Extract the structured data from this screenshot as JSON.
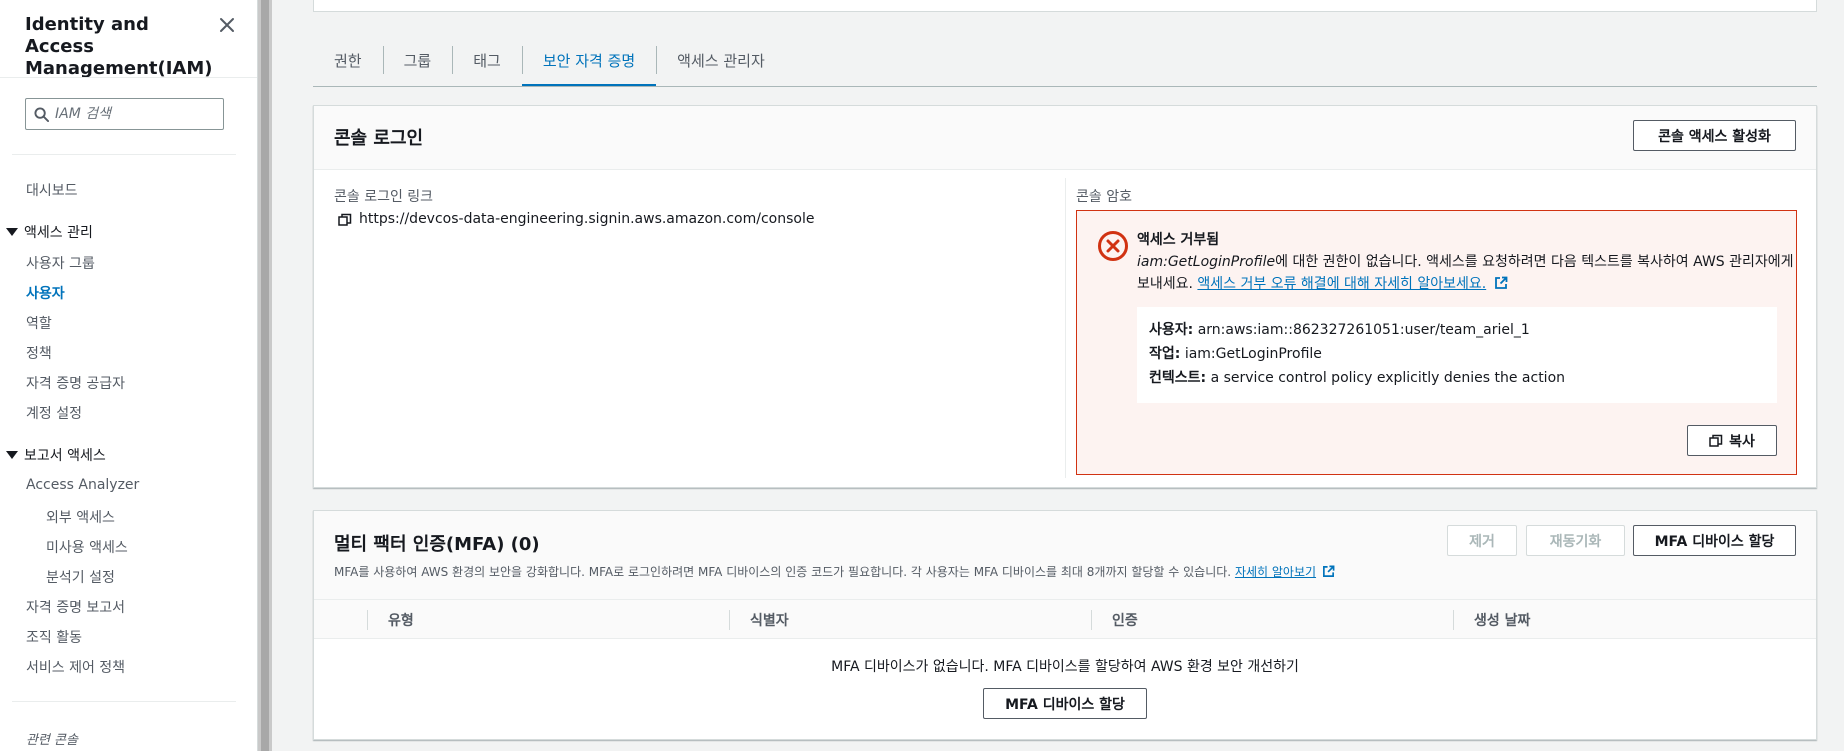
{
  "sidebar": {
    "title": "Identity and Access Management(IAM)",
    "search_placeholder": "IAM 검색",
    "dashboard": "대시보드",
    "access_mgmt": {
      "label": "액세스 관리",
      "items": [
        "사용자 그룹",
        "사용자",
        "역할",
        "정책",
        "자격 증명 공급자",
        "계정 설정"
      ],
      "active": "사용자"
    },
    "report_access": {
      "label": "보고서 액세스",
      "access_analyzer": "Access Analyzer",
      "analyzer_items": [
        "외부 액세스",
        "미사용 액세스",
        "분석기 설정"
      ],
      "items": [
        "자격 증명 보고서",
        "조직 활동",
        "서비스 제어 정책"
      ]
    },
    "related": "관련 콘솔"
  },
  "tabs": [
    "권한",
    "그룹",
    "태그",
    "보안 자격 증명",
    "액세스 관리자"
  ],
  "active_tab": "보안 자격 증명",
  "console_login": {
    "title": "콘솔 로그인",
    "enable_button": "콘솔 액세스 활성화",
    "link_label": "콘솔 로그인 링크",
    "link_url": "https://devcos-data-engineering.signin.aws.amazon.com/console",
    "password_label": "콘솔 암호",
    "alert": {
      "title": "액세스 거부됨",
      "permission": "iam:GetLoginProfile",
      "message_1": "에 대한 권한이 없습니다. 액세스를 요청하려면 다음 텍스트를 복사하여 AWS 관리자에게 보내세요. ",
      "learn_more": "액세스 거부 오류 해결에 대해 자세히 알아보세요.",
      "user_label": "사용자:",
      "user_value": "arn:aws:iam::862327261051:user/team_ariel_1",
      "action_label": "작업:",
      "action_value": "iam:GetLoginProfile",
      "context_label": "컨텍스트:",
      "context_value": "a service control policy explicitly denies the action",
      "copy_button": "복사"
    }
  },
  "mfa": {
    "title": "멀티 팩터 인증(MFA) (0)",
    "remove_button": "제거",
    "resync_button": "재동기화",
    "assign_button": "MFA 디바이스 할당",
    "description": "MFA를 사용하여 AWS 환경의 보안을 강화합니다. MFA로 로그인하려면 MFA 디바이스의 인증 코드가 필요합니다. 각 사용자는 MFA 디바이스를 최대 8개까지 할당할 수 있습니다. ",
    "learn_more": "자세히 알아보기",
    "columns": [
      "유형",
      "식별자",
      "인증",
      "생성 날짜"
    ],
    "empty_message": "MFA 디바이스가 없습니다. MFA 디바이스를 할당하여 AWS 환경 보안 개선하기",
    "empty_assign_button": "MFA 디바이스 할당"
  },
  "colors": {
    "link_blue": "#0073bb",
    "error_red": "#d13212",
    "error_bg": "#fdf3f1"
  }
}
